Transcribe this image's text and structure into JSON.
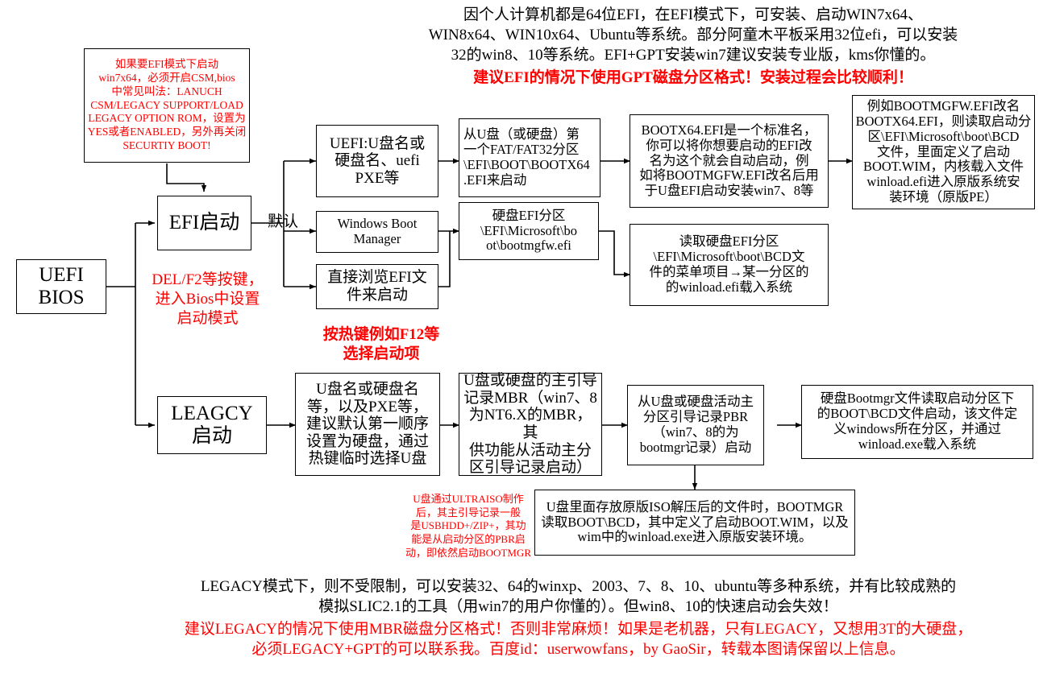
{
  "title": "UEFI / Legacy BIOS 启动流程图",
  "colors": {
    "text": "#000000",
    "accent_red": "#ff0000",
    "border": "#000000",
    "background": "#ffffff"
  },
  "header": {
    "black_paragraph": "因个人计算机都是64位EFI，在EFI模式下，可安装、启动WIN7x64、\nWIN8x64、WIN10x64、Ubuntu等系统。部分阿童木平板采用32位efi，可以安装\n32的win8、10等系统。EFI+GPT安装win7建议安装专业版，kms你懂的。",
    "red_line": "建议EFI的情况下使用GPT磁盘分区格式！安装过程会比较顺利！"
  },
  "notes": {
    "csm_note": "如果要EFI模式下启动\nwin7x64，必须开启CSM,bios\n中常见叫法：LANUCH\nCSM/LEGACY SUPPORT/LOAD\nLEGACY OPTION ROM，设置为\nYES或者ENABLED，另外再关闭\nSECURTIY BOOT!",
    "bios_key_note": "DEL/F2等按键，\n进入Bios中设置\n启动模式",
    "hotkey_note": "按热键例如F12等\n选择启动项",
    "default_label": "默认",
    "ultraiso_note": "U盘通过ULTRAISO制作\n后，其主引导记录一般\n是USBHDD+/ZIP+，其功\n能是从启动分区的PBR启\n动，即依然启动BOOTMGR"
  },
  "nodes": {
    "uefi_bios": "UEFI\nBIOS",
    "efi_boot": "EFI启动",
    "legacy_boot": "LEAGCY\n启动",
    "efi_opt1": "UEFI:U盘名或\n硬盘名、uefi\nPXE等",
    "efi_opt2": "Windows Boot\nManager",
    "efi_opt3": "直接浏览EFI文\n件来启动",
    "efi_path_usb": "从U盘（或硬盘）第\n一个FAT/FAT32分区\n\\EFI\\BOOT\\BOOTX64\n.EFI来启动",
    "efi_path_hdd": "硬盘EFI分区\n\\EFI\\Microsoft\\bo\not\\bootmgfw.efi",
    "bootx64_desc": "BOOTX64.EFI是一个标准名，\n你可以将你想要启动的EFI改\n名为这个就会自动启动，例\n如将BOOTMGFW.EFI改名后用\n于U盘EFI启动安装win7、8等",
    "bcd_read_desc": "读取硬盘EFI分区\n\\EFI\\Microsoft\\boot\\BCD文\n件的菜单项目→某一分区的\n的winload.efi载入系统",
    "rename_result": "例如BOOTMGFW.EFI改名\nBOOTX64.EFI，则读取启动分\n区\\EFI\\Microsoft\\boot\\BCD\n文件，里面定义了启动\nBOOT.WIM，内核载入文件\nwinload.efi进入原版系统安\n装环境（原版PE）",
    "legacy_opt1": "U盘名或硬盘名\n等，以及PXE等，\n建议默认第一顺序\n设置为硬盘，通过\n热键临时选择U盘",
    "legacy_mbr": "U盘或硬盘的主引导\n记录MBR（win7、8\n为NT6.X的MBR，其\n供功能从活动主分\n区引导记录启动）",
    "legacy_pbr": "从U盘或硬盘活动主\n分区引导记录PBR\n（win7、8的为\nbootmgr记录）启动",
    "legacy_bootmgr": "硬盘Bootmgr文件读取启动分区下\n的BOOT\\BCD文件启动，该文件定\n义windows所在分区，并通过\nwinload.exe载入系统",
    "iso_bootmgr": "U盘里面存放原版ISO解压后的文件时，BOOTMGR\n读取BOOT\\BCD，其中定义了启动BOOT.WIM，以及\nwim中的winload.exe进入原版安装环境。"
  },
  "footer": {
    "black_paragraph": "LEGACY模式下，则不受限制，可以安装32、64的winxp、2003、7、8、10、ubuntu等多种系统，并有比较成熟的\n模拟SLIC2.1的工具（用win7的用户你懂的）。但win8、10的快速启动会失效！",
    "red_paragraph": "建议LEGACY的情况下使用MBR磁盘分区格式！否则非常麻烦！如果是老机器，只有LEGACY，又想用3T的大硬盘，\n必须LEGACY+GPT的可以联系我。百度id：userwowfans，by GaoSir，转载本图请保留以上信息。"
  }
}
